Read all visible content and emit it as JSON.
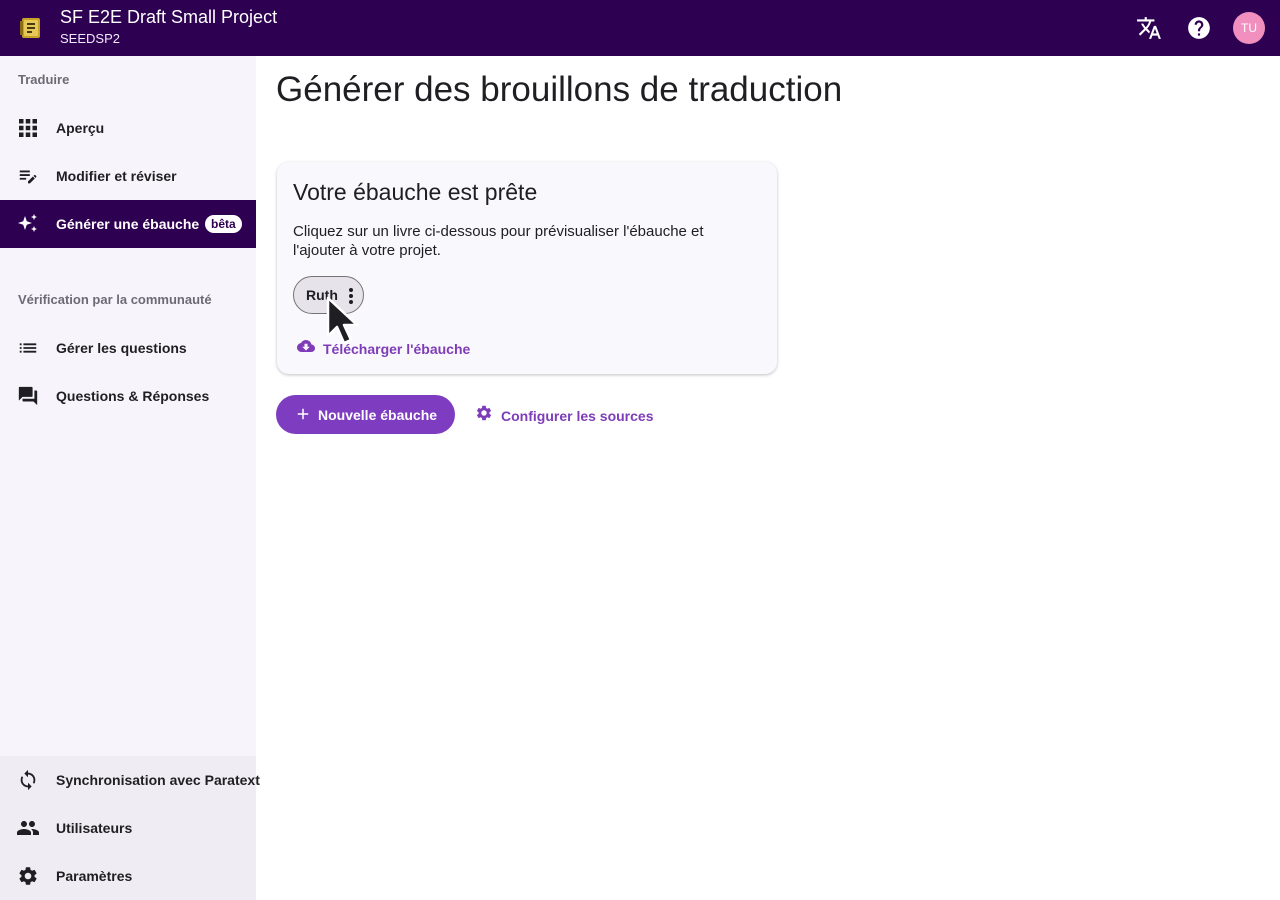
{
  "header": {
    "project_title": "SF E2E Draft Small Project",
    "project_code": "SEEDSP2",
    "avatar_initials": "TU",
    "avatar_color": "#f18fbf",
    "background_color": "#2d0052",
    "icons": [
      "app-logo-icon",
      "translate-icon",
      "help-icon"
    ]
  },
  "sidebar": {
    "section_translate": "Traduire",
    "items_translate": [
      {
        "label": "Aperçu",
        "icon": "grid-icon"
      },
      {
        "label": "Modifier et réviser",
        "icon": "edit-notes-icon"
      },
      {
        "label": "Générer une ébauche",
        "icon": "sparkle-icon",
        "badge": "bêta",
        "active": true
      }
    ],
    "section_community": "Vérification par la communauté",
    "items_community": [
      {
        "label": "Gérer les questions",
        "icon": "list-icon"
      },
      {
        "label": "Questions & Réponses",
        "icon": "forum-icon"
      }
    ],
    "items_bottom": [
      {
        "label": "Synchronisation avec Paratext",
        "icon": "sync-icon"
      },
      {
        "label": "Utilisateurs",
        "icon": "people-icon"
      },
      {
        "label": "Paramètres",
        "icon": "gear-icon"
      }
    ]
  },
  "main": {
    "page_title": "Générer des brouillons de traduction",
    "card": {
      "title": "Votre ébauche est prête",
      "description": "Cliquez sur un livre ci-dessous pour prévisualiser l'ébauche et l'ajouter à votre projet.",
      "book_chip": "Ruth",
      "download_label": "Télécharger l'ébauche"
    },
    "new_draft_button": "Nouvelle ébauche",
    "configure_sources_button": "Configurer les sources"
  },
  "colors": {
    "accent": "#7e3cc1",
    "link": "#7e3cb8",
    "sidebar_bg": "#f7f5fb"
  }
}
